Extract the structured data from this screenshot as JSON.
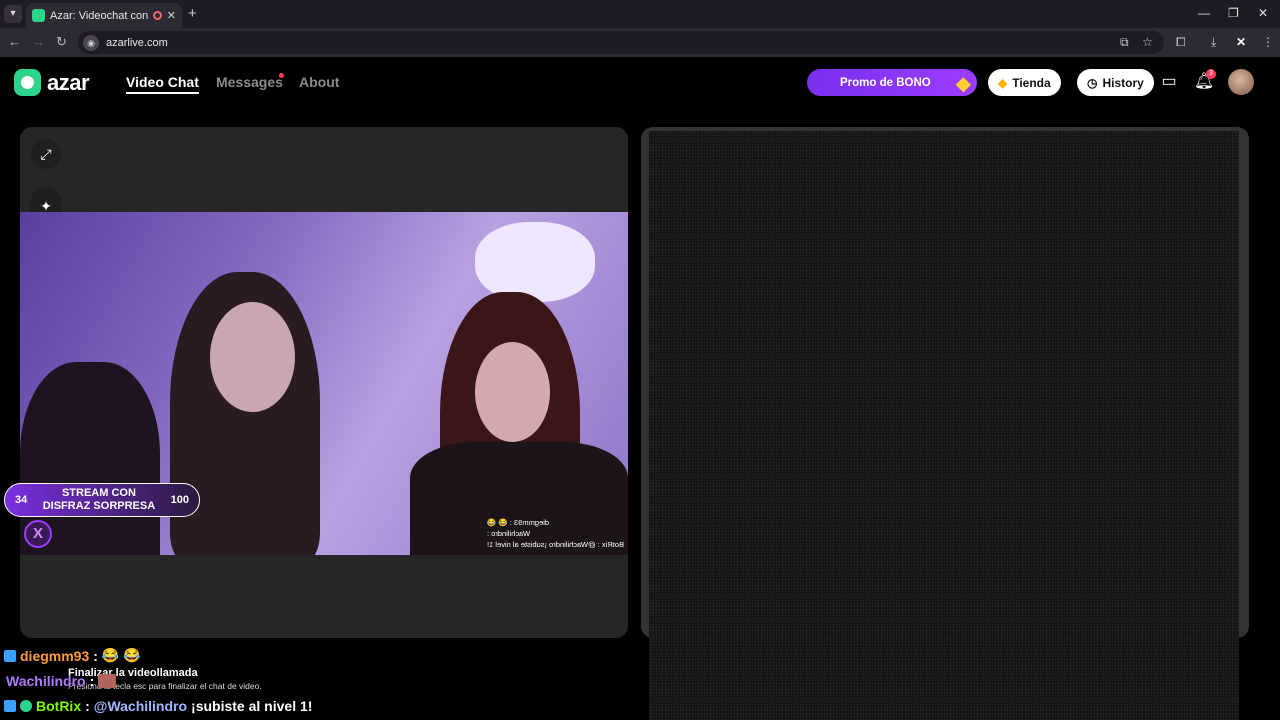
{
  "browser": {
    "tab_title": "Azar: Videochat con gente",
    "tab_close": "✕",
    "new_tab": "+",
    "url": "azarlive.com",
    "window_controls": {
      "minimize": "—",
      "restore": "❐",
      "close": "✕"
    }
  },
  "header": {
    "logo_text": "azar",
    "nav": [
      {
        "label": "Video Chat",
        "active": true
      },
      {
        "label": "Messages",
        "has_notification": true
      },
      {
        "label": "About"
      }
    ],
    "promo_label": "Promo de BONO",
    "store_label": "Tienda",
    "history_label": "History",
    "notification_count": "3"
  },
  "stream_overlay": {
    "left_value": "34",
    "label_line1": "STREAM CON",
    "label_line2": "DISFRAZ SORPRESA",
    "right_value": "100",
    "badge_letter": "X",
    "mirrored_chat": [
      "diegmm93 : 😂 😂",
      "Wachilindro :",
      "BotRix : @Wachilindro ¡subiste al nivel 1!"
    ]
  },
  "chat": [
    {
      "user": "diegmm93",
      "sep": " :",
      "msg": "😂 😂"
    },
    {
      "user": "Wachilindro",
      "sep": " :",
      "msg": ""
    },
    {
      "user": "BotRix",
      "sep": " :",
      "mention": "@Wachilindro",
      "msg": "¡subiste al nivel 1!"
    }
  ],
  "end_call": {
    "title": "Finalizar la videollamada",
    "hint": "Presiona la tecla esc para finalizar el chat de video."
  },
  "colors": {
    "accent": "#9b3dff",
    "brand": "#2bd48a"
  }
}
